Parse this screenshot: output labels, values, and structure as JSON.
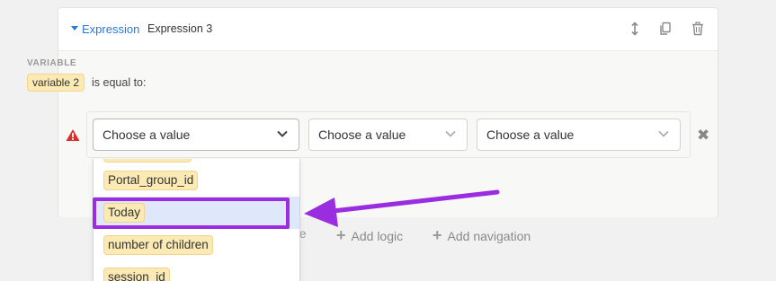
{
  "expression": {
    "type_label": "Expression",
    "name": "Expression 3",
    "icons": [
      "reorder-icon",
      "duplicate-icon",
      "trash-icon"
    ]
  },
  "variable": {
    "section_label": "VARIABLE",
    "tag": "variable 2",
    "operator_text": "is equal to:"
  },
  "condition": {
    "selects": [
      {
        "value": "Choose a value"
      },
      {
        "value": "Choose a value"
      },
      {
        "value": "Choose a value"
      }
    ]
  },
  "dropdown": {
    "options": [
      "Portal_group_id",
      "Today",
      "number of children",
      "session_id"
    ],
    "active_option": "Today"
  },
  "footer": {
    "partial_text": "ge",
    "add_logic": "Add logic",
    "add_navigation": "Add navigation"
  },
  "annotation": {
    "highlight_color": "#9b2de0",
    "arrow_color": "#9b2de0"
  },
  "colors": {
    "link_blue": "#2b78d6",
    "tag_yellow": "#fbeab4",
    "warning_red": "#d9302c"
  }
}
